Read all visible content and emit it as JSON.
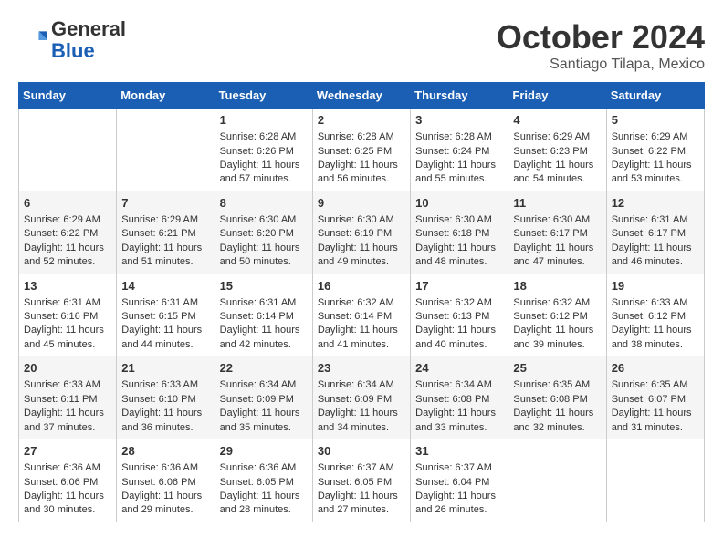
{
  "header": {
    "title": "October 2024",
    "location": "Santiago Tilapa, Mexico",
    "logo_general": "General",
    "logo_blue": "Blue"
  },
  "days_of_week": [
    "Sunday",
    "Monday",
    "Tuesday",
    "Wednesday",
    "Thursday",
    "Friday",
    "Saturday"
  ],
  "weeks": [
    [
      {
        "day": "",
        "sunrise": "",
        "sunset": "",
        "daylight": ""
      },
      {
        "day": "",
        "sunrise": "",
        "sunset": "",
        "daylight": ""
      },
      {
        "day": "1",
        "sunrise": "Sunrise: 6:28 AM",
        "sunset": "Sunset: 6:26 PM",
        "daylight": "Daylight: 11 hours and 57 minutes."
      },
      {
        "day": "2",
        "sunrise": "Sunrise: 6:28 AM",
        "sunset": "Sunset: 6:25 PM",
        "daylight": "Daylight: 11 hours and 56 minutes."
      },
      {
        "day": "3",
        "sunrise": "Sunrise: 6:28 AM",
        "sunset": "Sunset: 6:24 PM",
        "daylight": "Daylight: 11 hours and 55 minutes."
      },
      {
        "day": "4",
        "sunrise": "Sunrise: 6:29 AM",
        "sunset": "Sunset: 6:23 PM",
        "daylight": "Daylight: 11 hours and 54 minutes."
      },
      {
        "day": "5",
        "sunrise": "Sunrise: 6:29 AM",
        "sunset": "Sunset: 6:22 PM",
        "daylight": "Daylight: 11 hours and 53 minutes."
      }
    ],
    [
      {
        "day": "6",
        "sunrise": "Sunrise: 6:29 AM",
        "sunset": "Sunset: 6:22 PM",
        "daylight": "Daylight: 11 hours and 52 minutes."
      },
      {
        "day": "7",
        "sunrise": "Sunrise: 6:29 AM",
        "sunset": "Sunset: 6:21 PM",
        "daylight": "Daylight: 11 hours and 51 minutes."
      },
      {
        "day": "8",
        "sunrise": "Sunrise: 6:30 AM",
        "sunset": "Sunset: 6:20 PM",
        "daylight": "Daylight: 11 hours and 50 minutes."
      },
      {
        "day": "9",
        "sunrise": "Sunrise: 6:30 AM",
        "sunset": "Sunset: 6:19 PM",
        "daylight": "Daylight: 11 hours and 49 minutes."
      },
      {
        "day": "10",
        "sunrise": "Sunrise: 6:30 AM",
        "sunset": "Sunset: 6:18 PM",
        "daylight": "Daylight: 11 hours and 48 minutes."
      },
      {
        "day": "11",
        "sunrise": "Sunrise: 6:30 AM",
        "sunset": "Sunset: 6:17 PM",
        "daylight": "Daylight: 11 hours and 47 minutes."
      },
      {
        "day": "12",
        "sunrise": "Sunrise: 6:31 AM",
        "sunset": "Sunset: 6:17 PM",
        "daylight": "Daylight: 11 hours and 46 minutes."
      }
    ],
    [
      {
        "day": "13",
        "sunrise": "Sunrise: 6:31 AM",
        "sunset": "Sunset: 6:16 PM",
        "daylight": "Daylight: 11 hours and 45 minutes."
      },
      {
        "day": "14",
        "sunrise": "Sunrise: 6:31 AM",
        "sunset": "Sunset: 6:15 PM",
        "daylight": "Daylight: 11 hours and 44 minutes."
      },
      {
        "day": "15",
        "sunrise": "Sunrise: 6:31 AM",
        "sunset": "Sunset: 6:14 PM",
        "daylight": "Daylight: 11 hours and 42 minutes."
      },
      {
        "day": "16",
        "sunrise": "Sunrise: 6:32 AM",
        "sunset": "Sunset: 6:14 PM",
        "daylight": "Daylight: 11 hours and 41 minutes."
      },
      {
        "day": "17",
        "sunrise": "Sunrise: 6:32 AM",
        "sunset": "Sunset: 6:13 PM",
        "daylight": "Daylight: 11 hours and 40 minutes."
      },
      {
        "day": "18",
        "sunrise": "Sunrise: 6:32 AM",
        "sunset": "Sunset: 6:12 PM",
        "daylight": "Daylight: 11 hours and 39 minutes."
      },
      {
        "day": "19",
        "sunrise": "Sunrise: 6:33 AM",
        "sunset": "Sunset: 6:12 PM",
        "daylight": "Daylight: 11 hours and 38 minutes."
      }
    ],
    [
      {
        "day": "20",
        "sunrise": "Sunrise: 6:33 AM",
        "sunset": "Sunset: 6:11 PM",
        "daylight": "Daylight: 11 hours and 37 minutes."
      },
      {
        "day": "21",
        "sunrise": "Sunrise: 6:33 AM",
        "sunset": "Sunset: 6:10 PM",
        "daylight": "Daylight: 11 hours and 36 minutes."
      },
      {
        "day": "22",
        "sunrise": "Sunrise: 6:34 AM",
        "sunset": "Sunset: 6:09 PM",
        "daylight": "Daylight: 11 hours and 35 minutes."
      },
      {
        "day": "23",
        "sunrise": "Sunrise: 6:34 AM",
        "sunset": "Sunset: 6:09 PM",
        "daylight": "Daylight: 11 hours and 34 minutes."
      },
      {
        "day": "24",
        "sunrise": "Sunrise: 6:34 AM",
        "sunset": "Sunset: 6:08 PM",
        "daylight": "Daylight: 11 hours and 33 minutes."
      },
      {
        "day": "25",
        "sunrise": "Sunrise: 6:35 AM",
        "sunset": "Sunset: 6:08 PM",
        "daylight": "Daylight: 11 hours and 32 minutes."
      },
      {
        "day": "26",
        "sunrise": "Sunrise: 6:35 AM",
        "sunset": "Sunset: 6:07 PM",
        "daylight": "Daylight: 11 hours and 31 minutes."
      }
    ],
    [
      {
        "day": "27",
        "sunrise": "Sunrise: 6:36 AM",
        "sunset": "Sunset: 6:06 PM",
        "daylight": "Daylight: 11 hours and 30 minutes."
      },
      {
        "day": "28",
        "sunrise": "Sunrise: 6:36 AM",
        "sunset": "Sunset: 6:06 PM",
        "daylight": "Daylight: 11 hours and 29 minutes."
      },
      {
        "day": "29",
        "sunrise": "Sunrise: 6:36 AM",
        "sunset": "Sunset: 6:05 PM",
        "daylight": "Daylight: 11 hours and 28 minutes."
      },
      {
        "day": "30",
        "sunrise": "Sunrise: 6:37 AM",
        "sunset": "Sunset: 6:05 PM",
        "daylight": "Daylight: 11 hours and 27 minutes."
      },
      {
        "day": "31",
        "sunrise": "Sunrise: 6:37 AM",
        "sunset": "Sunset: 6:04 PM",
        "daylight": "Daylight: 11 hours and 26 minutes."
      },
      {
        "day": "",
        "sunrise": "",
        "sunset": "",
        "daylight": ""
      },
      {
        "day": "",
        "sunrise": "",
        "sunset": "",
        "daylight": ""
      }
    ]
  ]
}
